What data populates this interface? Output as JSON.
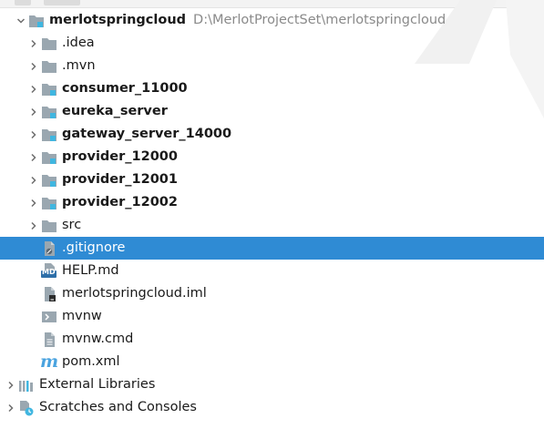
{
  "project": {
    "name": "merlotspringcloud",
    "path": "D:\\MerlotProjectSet\\merlotspringcloud"
  },
  "tree": {
    "folders": [
      {
        "label": ".idea",
        "module": false
      },
      {
        "label": ".mvn",
        "module": false
      },
      {
        "label": "consumer_11000",
        "module": true
      },
      {
        "label": "eureka_server",
        "module": true
      },
      {
        "label": "gateway_server_14000",
        "module": true
      },
      {
        "label": "provider_12000",
        "module": true
      },
      {
        "label": "provider_12001",
        "module": true
      },
      {
        "label": "provider_12002",
        "module": true
      },
      {
        "label": "src",
        "module": false
      }
    ],
    "files": [
      {
        "label": ".gitignore",
        "icon": "gitignore-file-icon",
        "selected": true
      },
      {
        "label": "HELP.md",
        "icon": "markdown-file-icon",
        "selected": false
      },
      {
        "label": "merlotspringcloud.iml",
        "icon": "iml-file-icon",
        "selected": false
      },
      {
        "label": "mvnw",
        "icon": "shell-script-icon",
        "selected": false
      },
      {
        "label": "mvnw.cmd",
        "icon": "text-file-icon",
        "selected": false
      },
      {
        "label": "pom.xml",
        "icon": "maven-icon",
        "selected": false
      }
    ],
    "external_libraries": "External Libraries",
    "scratches": "Scratches and Consoles"
  },
  "icon_badge": {
    "md": "MD",
    "maven": "m"
  },
  "colors": {
    "selection": "#2f8bd4",
    "folder": "#9aa7b0",
    "module_badge": "#40b6e0",
    "path_text": "#8a8a8a"
  }
}
